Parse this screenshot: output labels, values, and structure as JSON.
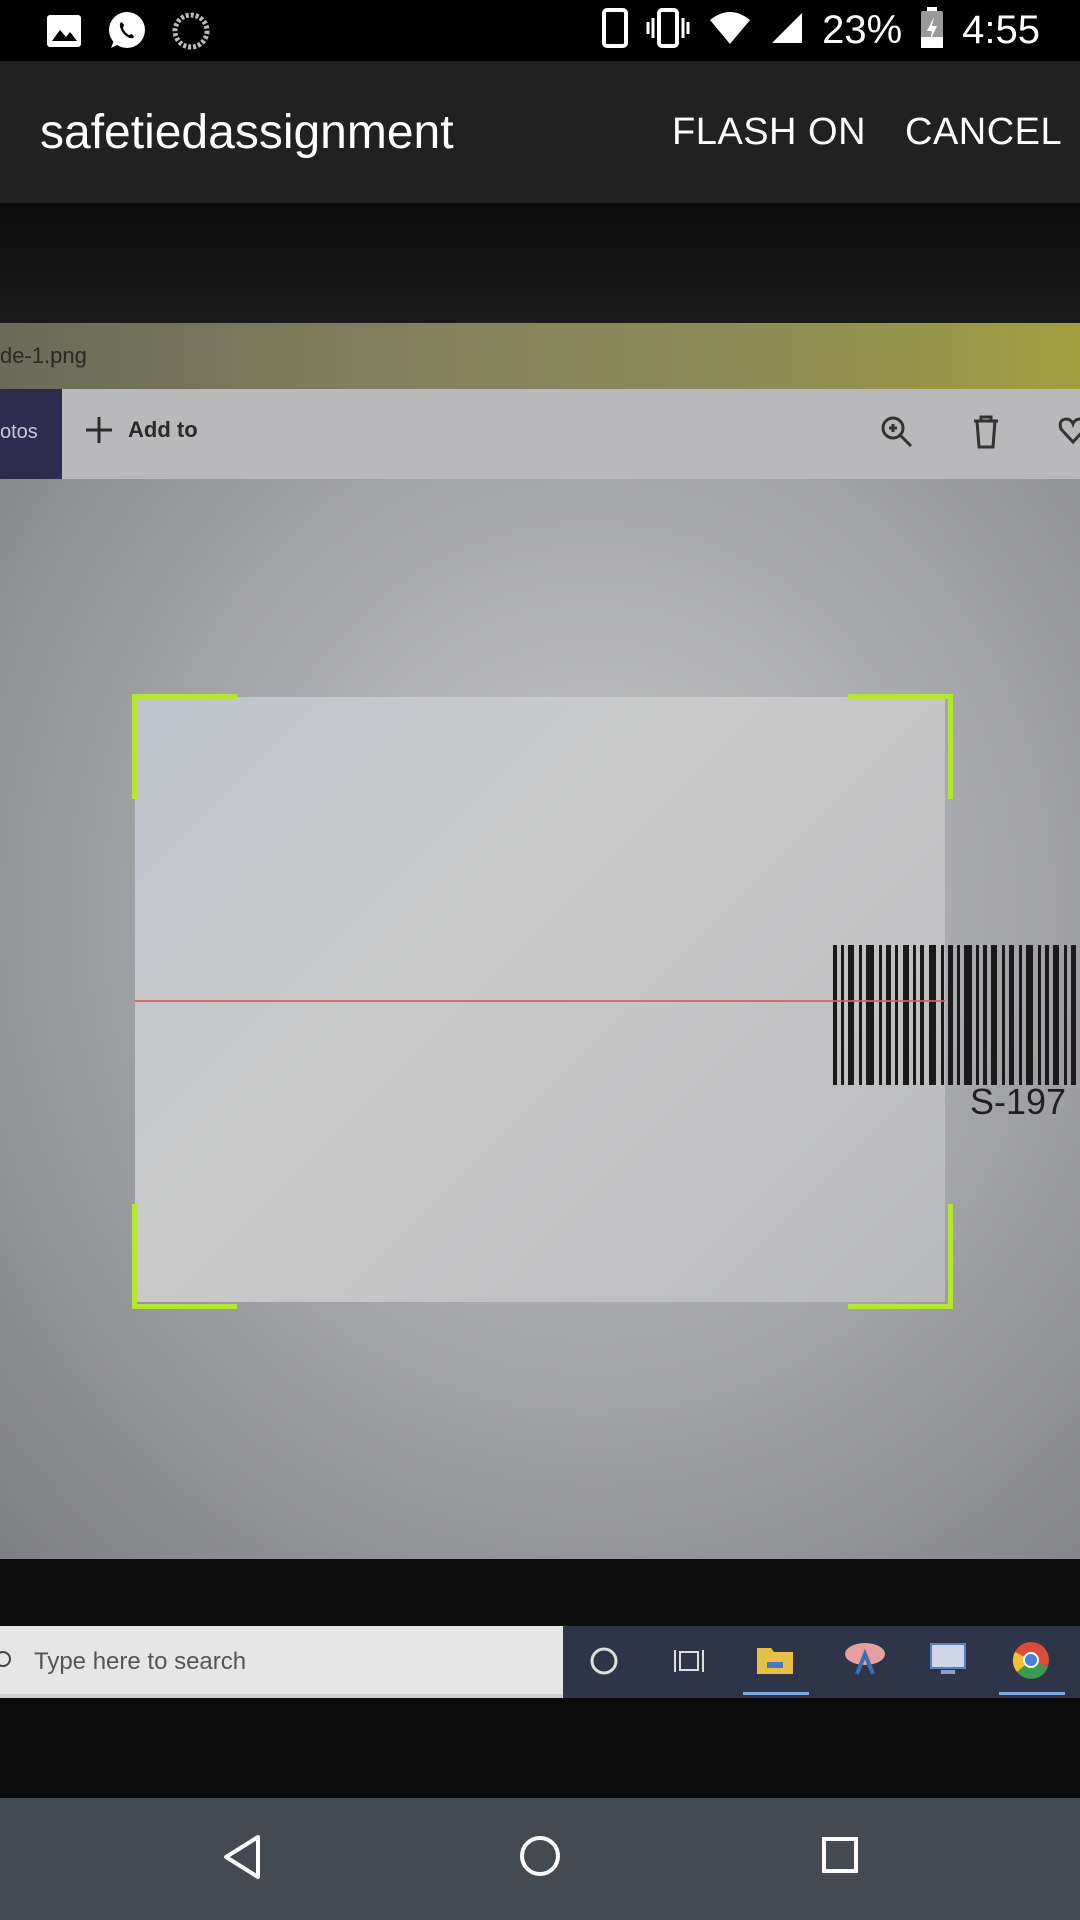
{
  "status_bar": {
    "battery": "23%",
    "time": "4:55",
    "icons": [
      "image-icon",
      "whatsapp-icon",
      "sync-icon",
      "phone-icon",
      "vibrate-icon",
      "wifi-icon",
      "signal-icon",
      "battery-charging-icon"
    ]
  },
  "app_bar": {
    "title": "safetiedassignment",
    "flash_label": "FLASH ON",
    "cancel_label": "CANCEL"
  },
  "preview": {
    "window_filename": "de-1.png",
    "photos_tab": "otos",
    "add_to_label": "Add to",
    "barcode_text": "S-197",
    "taskbar_search_placeholder": "Type here to search",
    "taskbar_icons": [
      "cortana-icon",
      "task-view-icon",
      "file-explorer-icon",
      "snipping-tool-icon",
      "remote-desktop-icon",
      "chrome-icon"
    ]
  },
  "scanner": {
    "frame_color": "#b4e632",
    "laser_color": "#e05a5a"
  },
  "nav_bar": {
    "buttons": [
      "back-icon",
      "home-icon",
      "recents-icon"
    ]
  }
}
